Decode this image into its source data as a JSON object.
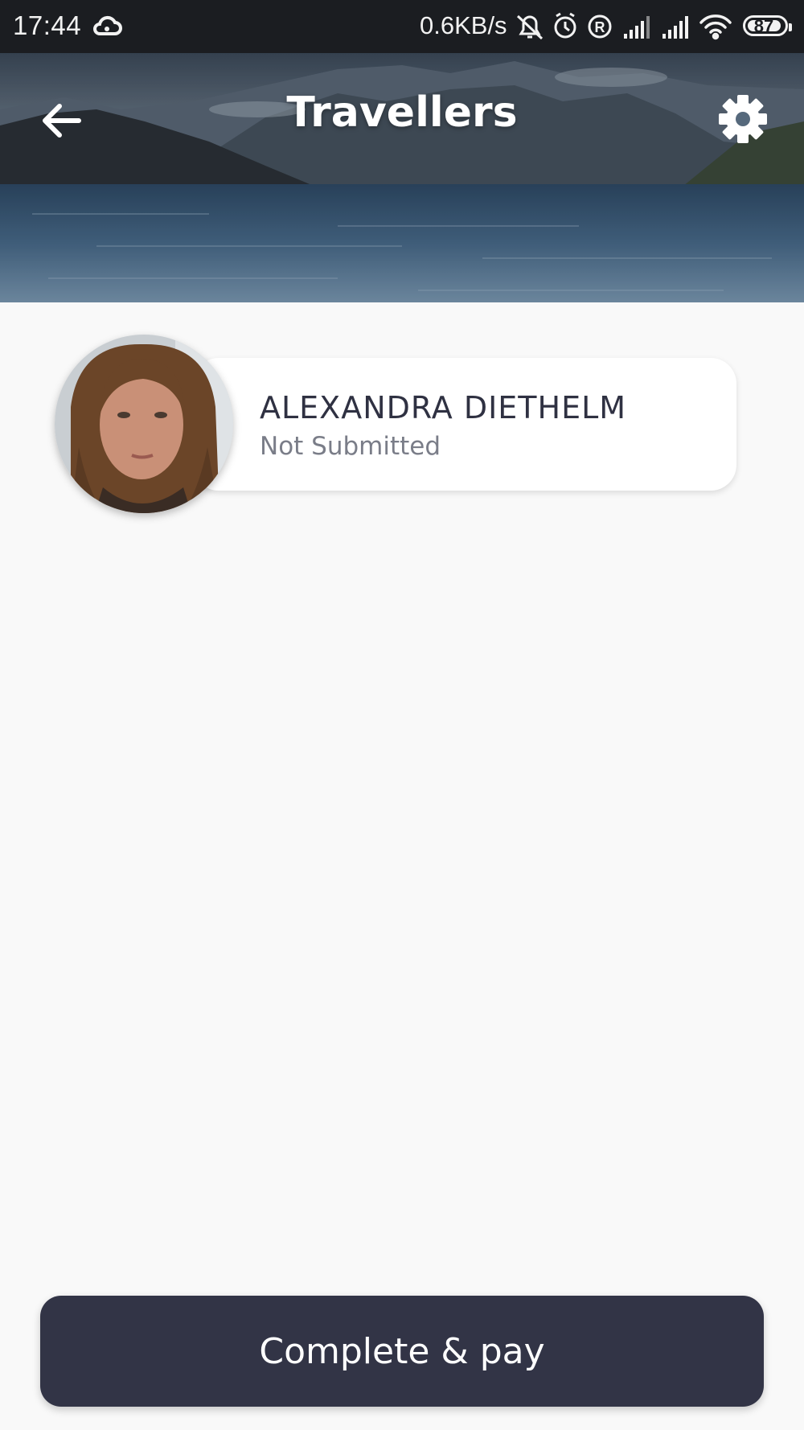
{
  "status_bar": {
    "time": "17:44",
    "network_speed": "0.6KB/s",
    "battery_level": "87",
    "icons": [
      "cloud-icon",
      "bell-muted-icon",
      "alarm-icon",
      "registered-icon",
      "signal-icon",
      "signal-icon",
      "wifi-icon",
      "battery-icon"
    ]
  },
  "header": {
    "title": "Travellers",
    "back_icon": "arrow-left-icon",
    "settings_icon": "gear-icon"
  },
  "travellers": [
    {
      "name": "ALEXANDRA DIETHELM",
      "status": "Not Submitted"
    }
  ],
  "footer": {
    "primary_button_label": "Complete & pay"
  },
  "colors": {
    "background": "#f9f9f9",
    "button": "#323446",
    "name_text": "#2f3142",
    "status_text": "#7a7d88"
  }
}
